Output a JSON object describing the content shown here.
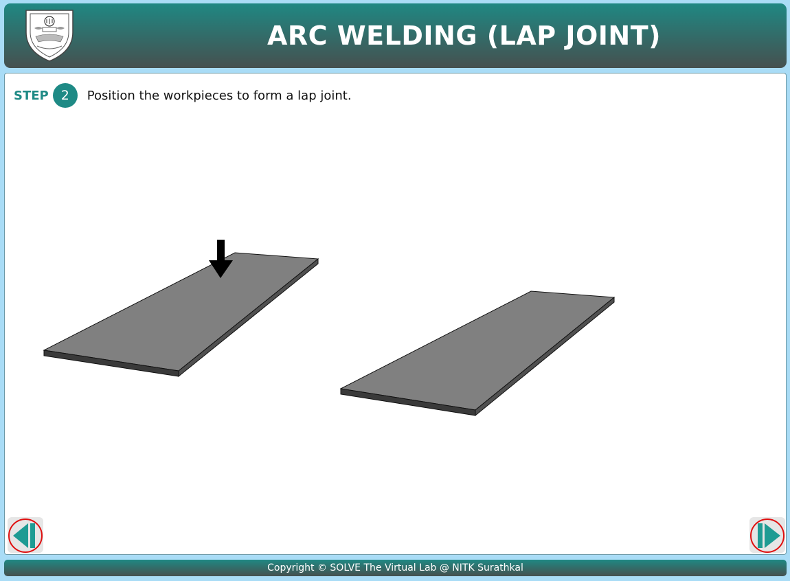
{
  "header": {
    "title": "ARC WELDING (LAP JOINT)",
    "logo_icon": "nitk-emblem-icon"
  },
  "step": {
    "label": "STEP",
    "number": "2",
    "instruction": "Position the workpieces to form a lap joint."
  },
  "scene": {
    "workpiece_color": "#808080",
    "workpiece_edge_color": "#3a3a3a",
    "arrow_icon": "down-arrow-icon"
  },
  "nav": {
    "prev_icon": "previous-step-icon",
    "next_icon": "next-step-icon",
    "accent_color": "#1e9b93",
    "ring_color": "#e01010"
  },
  "footer": {
    "copyright": "Copyright © SOLVE The Virtual Lab @ NITK Surathkal"
  }
}
